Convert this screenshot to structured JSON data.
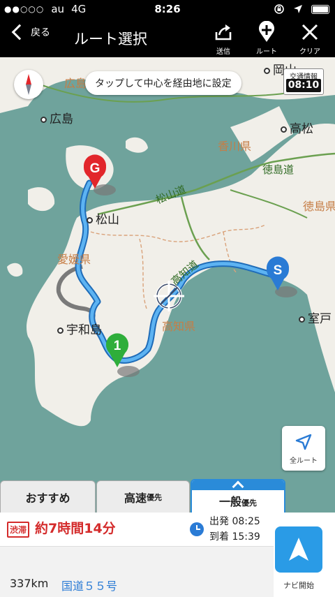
{
  "status_bar": {
    "signal": "●●○○○",
    "carrier": "au",
    "network": "4G",
    "time": "8:26"
  },
  "nav": {
    "back_label": "戻る",
    "title": "ルート選択",
    "actions": [
      {
        "label": "送信",
        "icon": "share-icon"
      },
      {
        "label": "ルート",
        "icon": "add-waypoint-icon"
      },
      {
        "label": "クリア",
        "icon": "close-icon"
      }
    ]
  },
  "map": {
    "hint": "タップして中心を経由地に設定",
    "traffic_info": {
      "label": "交通情報",
      "time": "08:10"
    },
    "cities": [
      {
        "name": "岡山"
      },
      {
        "name": "広島"
      },
      {
        "name": "高松"
      },
      {
        "name": "松山"
      },
      {
        "name": "宇和島"
      },
      {
        "name": "室戸"
      }
    ],
    "prefectures": [
      "広島県",
      "香川県",
      "徳島県",
      "愛媛県",
      "高知県",
      "岡山"
    ],
    "roads": [
      "徳島道",
      "松山道",
      "高知道"
    ],
    "markers": {
      "start": "S",
      "goal": "G",
      "waypoint": "1"
    },
    "all_route_label": "全ルート",
    "colors": {
      "sea": "#6fa39c",
      "land": "#f1efe9",
      "route": "#4ea8ef",
      "alt_route": "#8a8a8a"
    }
  },
  "tabs": [
    {
      "label": "おすすめ",
      "suffix": ""
    },
    {
      "label": "高速",
      "suffix": "優先"
    },
    {
      "label": "一般",
      "suffix": "優先"
    }
  ],
  "route_info": {
    "jam_badge": "渋滞",
    "duration": "約7時間14分",
    "depart_label": "出発",
    "depart_time": "08:25",
    "arrive_label": "到着",
    "arrive_time": "15:39",
    "distance": "337km",
    "road": "国道５５号",
    "navi_label": "ナビ開始"
  }
}
